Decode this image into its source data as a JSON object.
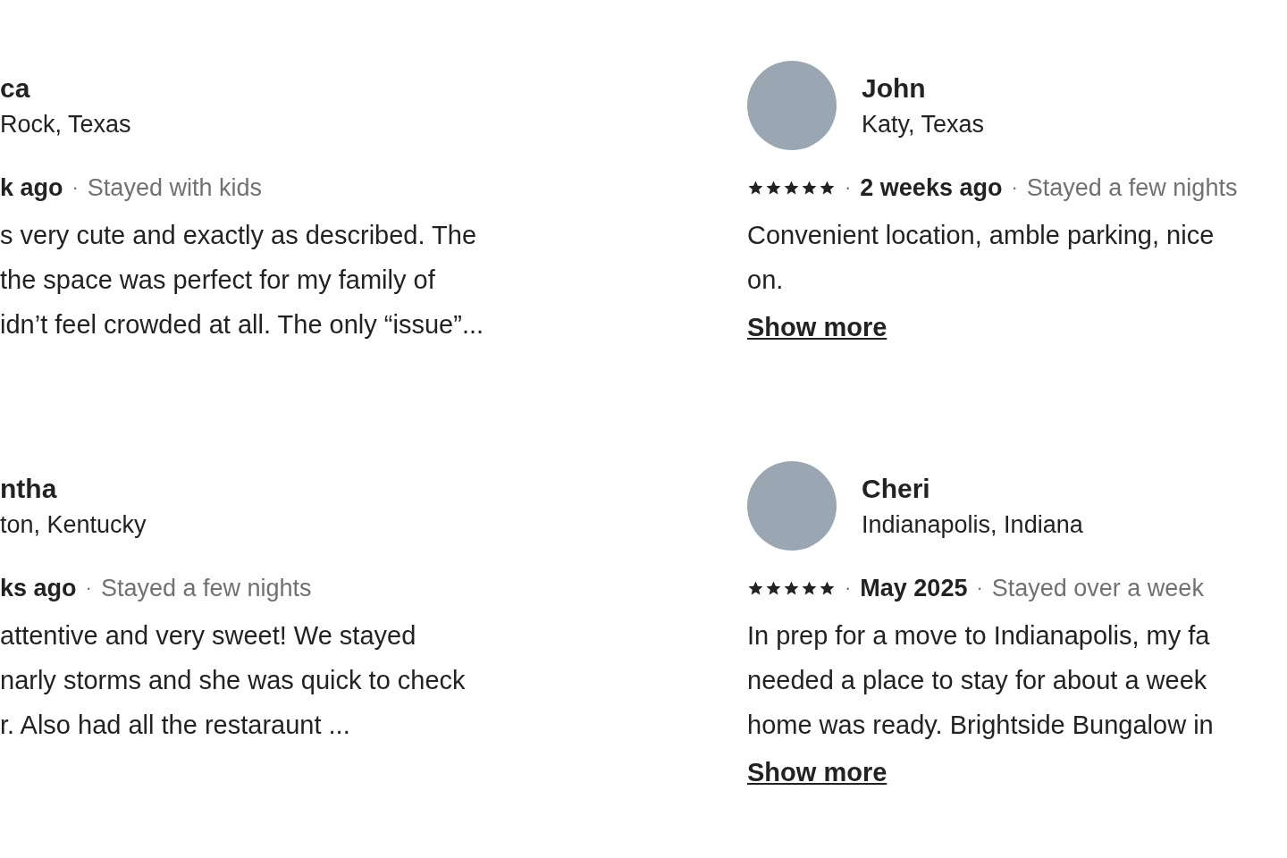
{
  "reviews": [
    {
      "avatar": false,
      "name": "ca",
      "location": "Rock, Texas",
      "meta": [
        {
          "kind": "date",
          "text": "k ago"
        },
        {
          "kind": "separator",
          "text": "·"
        },
        {
          "kind": "stay",
          "text": "Stayed with kids"
        }
      ],
      "body_lines": [
        "s very cute and exactly as described. The",
        "the space was perfect for my family of",
        "idn’t feel crowded at all. The only “issue”..."
      ]
    },
    {
      "avatar": true,
      "name": "John",
      "location": "Katy, Texas",
      "meta": [
        {
          "kind": "stars",
          "stars": 5
        },
        {
          "kind": "separator",
          "text": "·"
        },
        {
          "kind": "date",
          "text": "2 weeks ago"
        },
        {
          "kind": "separator",
          "text": "·"
        },
        {
          "kind": "stay",
          "text": "Stayed a few nights"
        }
      ],
      "body_lines": [
        "Convenient location, amble parking, nice",
        "on."
      ],
      "show_more": "Show more"
    },
    {
      "avatar": false,
      "name": "ntha",
      "location": "ton, Kentucky",
      "meta": [
        {
          "kind": "date",
          "text": "ks ago"
        },
        {
          "kind": "separator",
          "text": "·"
        },
        {
          "kind": "stay",
          "text": "Stayed a few nights"
        }
      ],
      "body_lines": [
        "attentive and very sweet! We stayed",
        "narly storms and she was quick to check",
        "r. Also had all the restaraunt ..."
      ]
    },
    {
      "avatar": true,
      "name": "Cheri",
      "location": "Indianapolis, Indiana",
      "meta": [
        {
          "kind": "stars",
          "stars": 5
        },
        {
          "kind": "separator",
          "text": "·"
        },
        {
          "kind": "date",
          "text": "May 2025"
        },
        {
          "kind": "separator",
          "text": "·"
        },
        {
          "kind": "stay",
          "text": "Stayed over a week"
        }
      ],
      "body_lines": [
        "In prep for a move to Indianapolis, my fa",
        "needed a place to stay for about a week",
        "home was ready. Brightside Bungalow in"
      ],
      "show_more": "Show more"
    }
  ]
}
